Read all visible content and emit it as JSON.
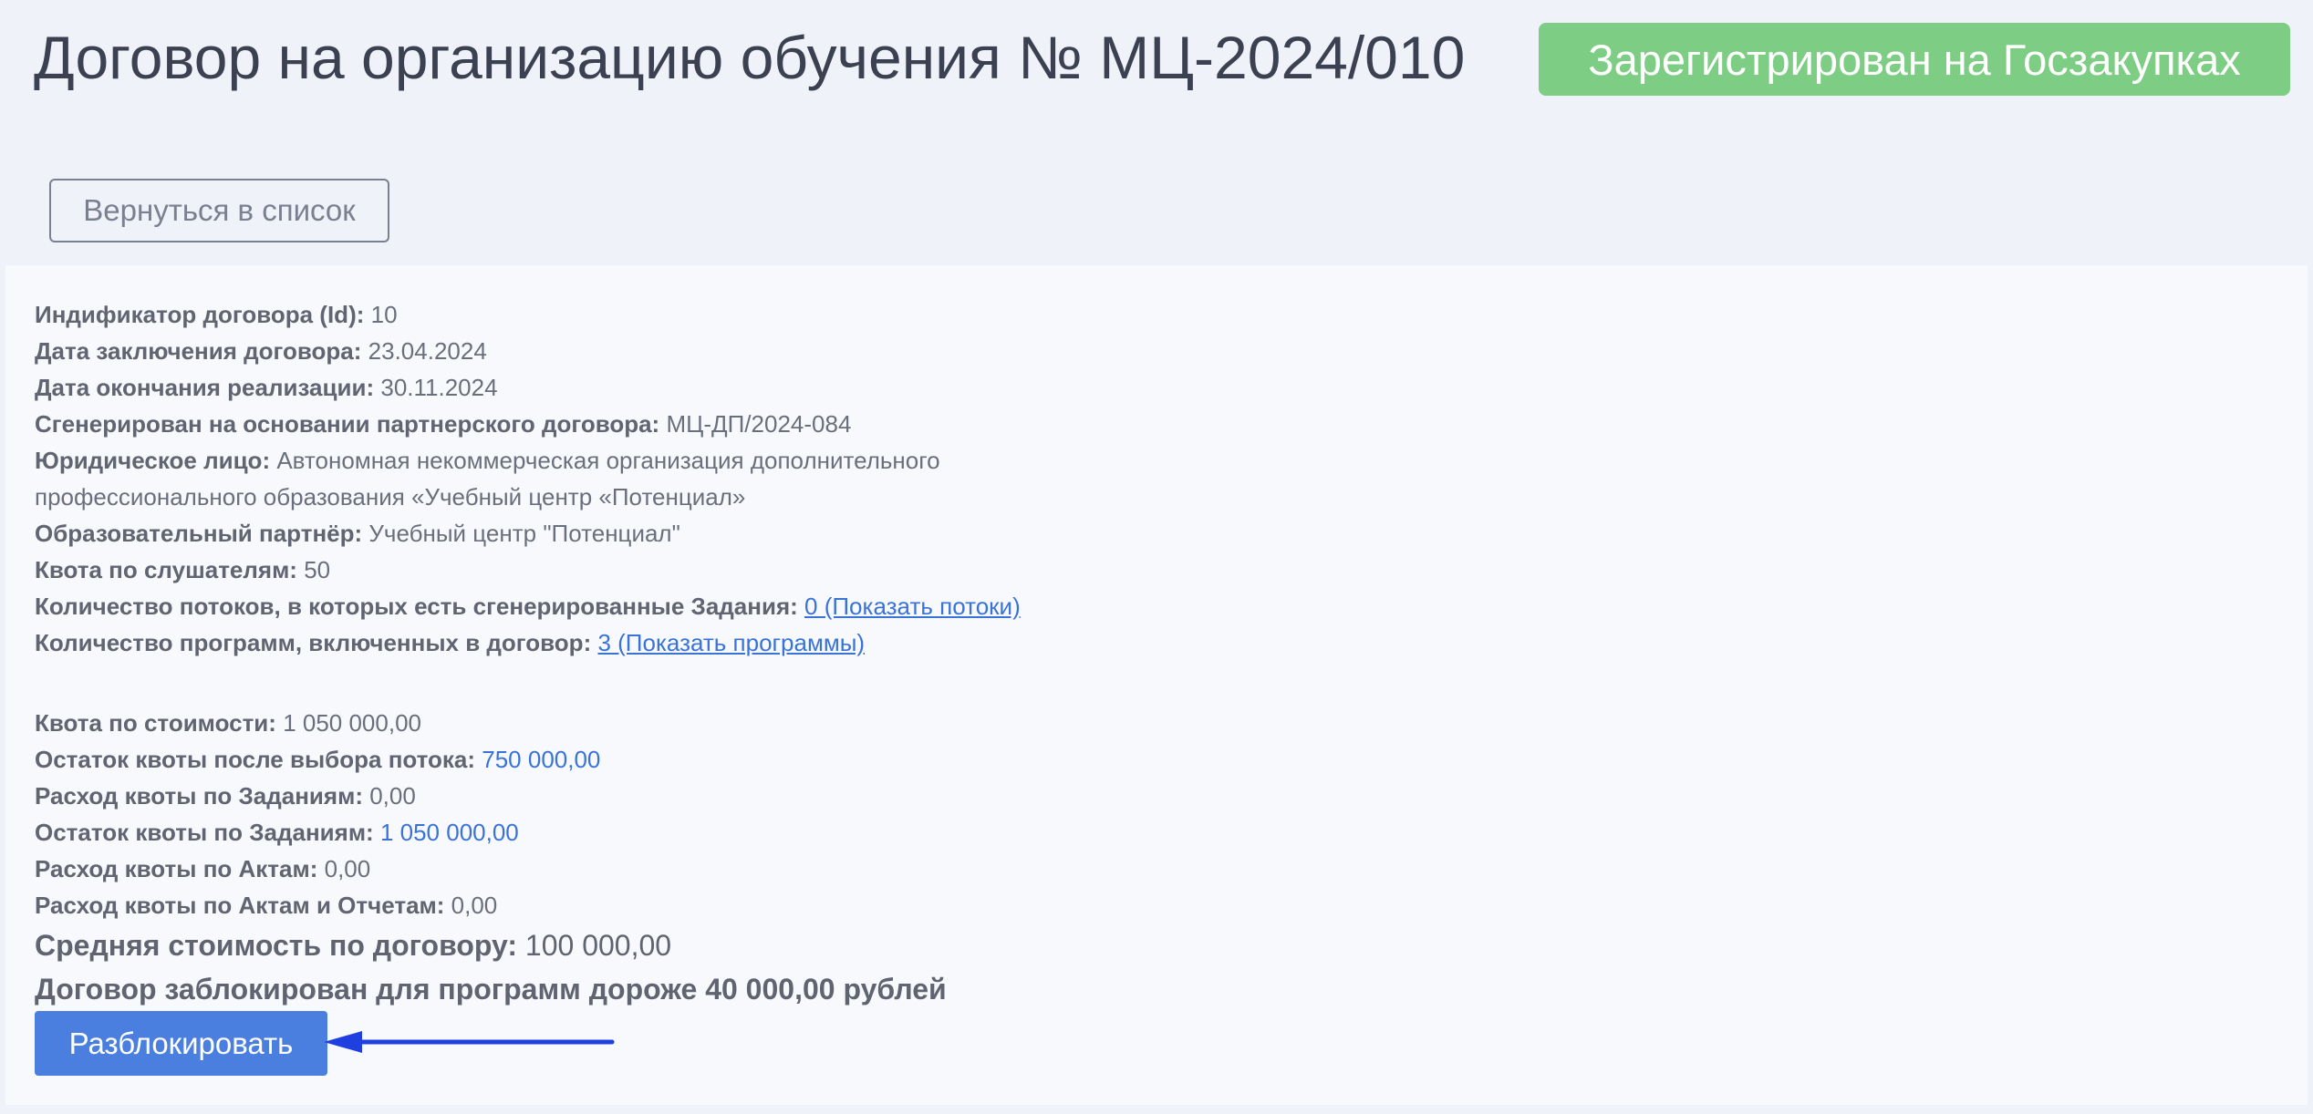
{
  "header": {
    "title": "Договор на организацию обучения № МЦ-2024/010",
    "status_badge": "Зарегистрирован на Госзакупках",
    "status_color": "#7ecd84"
  },
  "back_button": {
    "label": "Вернуться в список"
  },
  "details": {
    "id": {
      "label": "Индификатор договора (Id):",
      "value": "10"
    },
    "date_signed": {
      "label": "Дата заключения договора:",
      "value": "23.04.2024"
    },
    "date_end": {
      "label": "Дата окончания реализации:",
      "value": "30.11.2024"
    },
    "partner_contract": {
      "label": "Сгенерирован на основании партнерского договора:",
      "value": "МЦ-ДП/2024-084"
    },
    "legal_entity": {
      "label": "Юридическое лицо:",
      "value_line1": "Автономная некоммерческая организация дополнительного",
      "value_line2": "профессионального образования «Учебный центр «Потенциал»"
    },
    "edu_partner": {
      "label": "Образовательный партнёр:",
      "value": "Учебный центр \"Потенциал\""
    },
    "listener_quota": {
      "label": "Квота по слушателям:",
      "value": "50"
    },
    "streams_count": {
      "label": "Количество потоков, в которых есть сгенерированные Задания:",
      "link": "0 (Показать потоки)"
    },
    "programs_count": {
      "label": "Количество программ, включенных в договор:",
      "link": "3 (Показать программы)"
    }
  },
  "finance": {
    "cost_quota": {
      "label": "Квота по стоимости:",
      "value": "1 050 000,00"
    },
    "quota_after_stream": {
      "label": "Остаток квоты после выбора потока:",
      "value": "750 000,00"
    },
    "spent_tasks": {
      "label": "Расход квоты по Заданиям:",
      "value": "0,00"
    },
    "remaining_tasks": {
      "label": "Остаток квоты по Заданиям:",
      "value": "1 050 000,00"
    },
    "spent_acts": {
      "label": "Расход квоты по Актам:",
      "value": "0,00"
    },
    "spent_acts_reports": {
      "label": "Расход квоты по Актам и Отчетам:",
      "value": "0,00"
    },
    "avg_cost": {
      "label": "Средняя стоимость по договору:",
      "value": "100 000,00"
    },
    "blocked_text": "Договор заблокирован для программ дороже 40 000,00 рублей"
  },
  "unlock_button": {
    "label": "Разблокировать"
  },
  "colors": {
    "background": "#eff2f9",
    "card": "#f8f9fd",
    "accent_blue": "#4a7fe0",
    "link_blue": "#3a73d8",
    "arrow_blue": "#1f3fe0"
  }
}
